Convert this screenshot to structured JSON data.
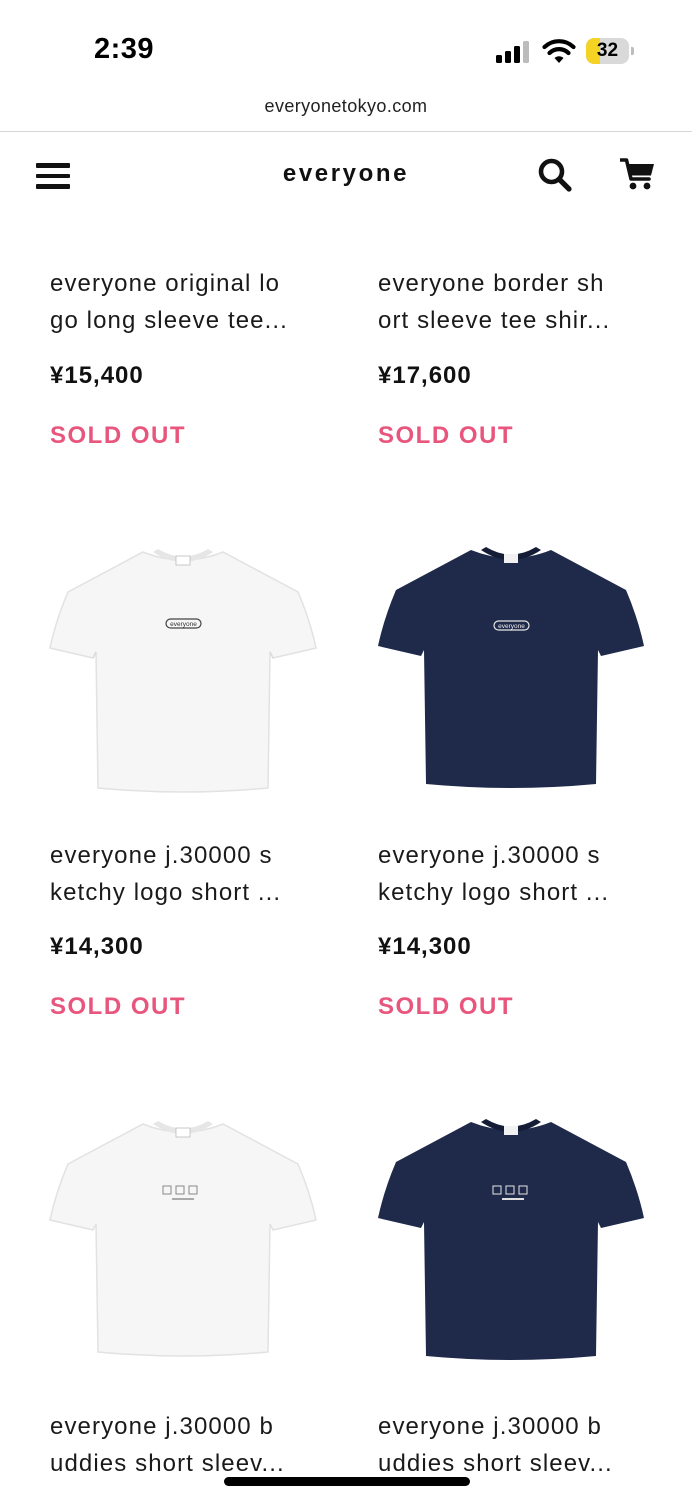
{
  "status_bar": {
    "time": "2:39",
    "battery_level": "32",
    "battery_fraction": 0.32,
    "battery_color": "#f5d325"
  },
  "url_bar": {
    "url": "everyonetokyo.com"
  },
  "header": {
    "brand": "everyone",
    "menu_icon": "hamburger-menu-icon",
    "search_icon": "search-icon",
    "cart_icon": "shopping-cart-icon"
  },
  "colors": {
    "sold_out": "#e8567e",
    "navy": "#1f2a4a",
    "white_tee": "#f4f4f4"
  },
  "products": [
    {
      "name_line1": "everyone original lo",
      "name_line2": "go long sleeve tee...",
      "price": "¥15,400",
      "status": "SOLD OUT"
    },
    {
      "name_line1": "everyone border sh",
      "name_line2": "ort sleeve tee shir...",
      "price": "¥17,600",
      "status": "SOLD OUT"
    },
    {
      "name_line1": "everyone j.30000 s",
      "name_line2": "ketchy logo short ...",
      "price": "¥14,300",
      "status": "SOLD OUT",
      "image_color": "white",
      "chest_print": "everyone"
    },
    {
      "name_line1": "everyone j.30000 s",
      "name_line2": "ketchy logo short ...",
      "price": "¥14,300",
      "status": "SOLD OUT",
      "image_color": "navy",
      "chest_print": "everyone"
    },
    {
      "name_line1": "everyone j.30000 b",
      "name_line2": "uddies short sleev...",
      "image_color": "white"
    },
    {
      "name_line1": "everyone j.30000 b",
      "name_line2": "uddies short sleev...",
      "image_color": "navy"
    }
  ]
}
